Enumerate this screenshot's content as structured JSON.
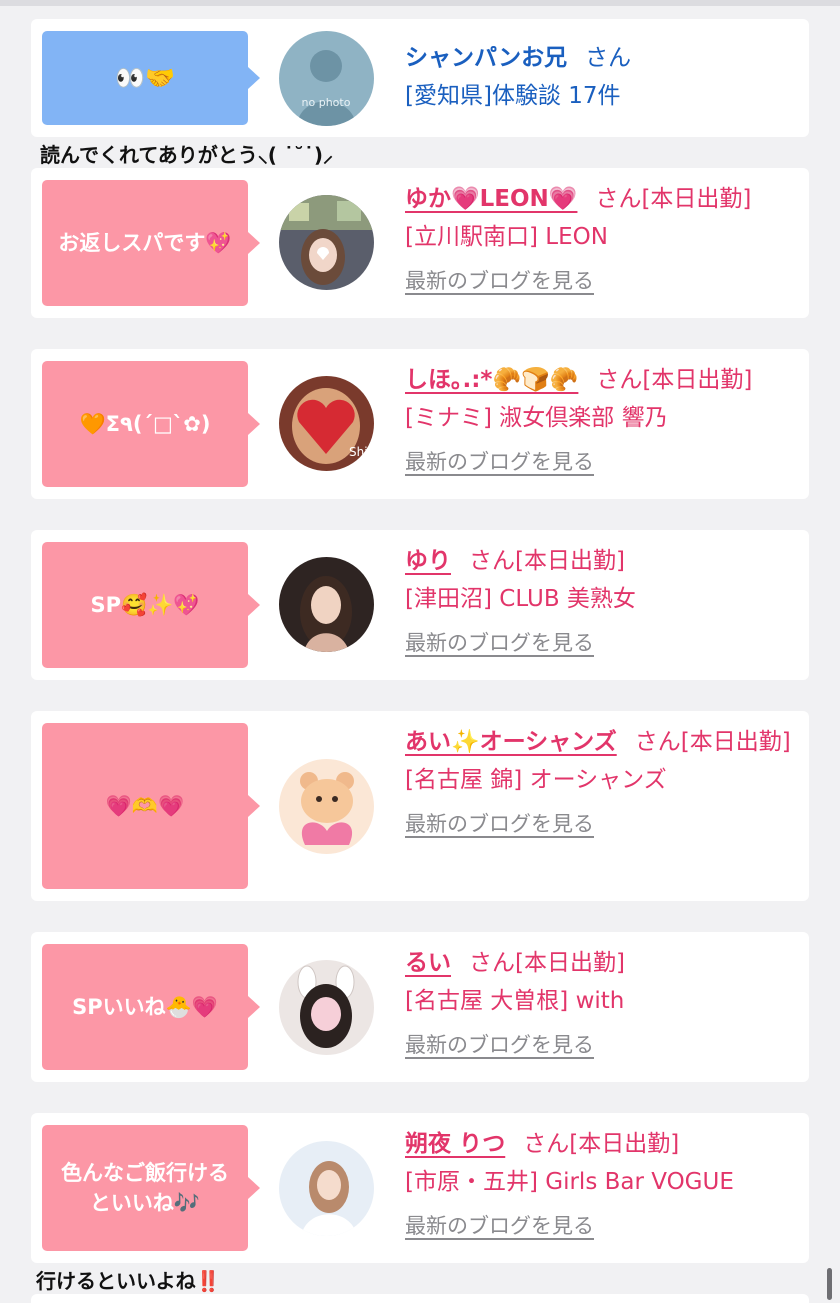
{
  "accent": {
    "pink": "#e2356a",
    "bubble_pink": "#fc97a6",
    "bubble_blue": "#82b4f5",
    "blue_text": "#1a5fbf"
  },
  "first": {
    "bubble": "👀🤝",
    "avatar_text": "no photo",
    "name": "シャンパンお兄",
    "san": "さん",
    "location": "[愛知県]体験談 17件"
  },
  "comment_top": "読んでくれてありがとう⸜( ˙˘˙)⸝",
  "comment_bottom": "行けるといいよね‼️",
  "entries": [
    {
      "bubble": "お返しスパです💖",
      "name": "ゆか💗LEON💗",
      "suffix": "さん[本日出勤]",
      "shop": "[立川駅南口] LEON",
      "blog": "最新のブログを見る"
    },
    {
      "bubble": "🧡Σ٩(ˊ□ˋ✿)",
      "name": "しほ｡.:*🥐🍞🥐",
      "suffix": "さん[本日出勤]",
      "shop": "[ミナミ] 淑女倶楽部 響乃",
      "blog": "最新のブログを見る"
    },
    {
      "bubble": "SP🥰✨💖",
      "name": "ゆり",
      "suffix": "さん[本日出勤]",
      "shop": "[津田沼] CLUB 美熟女",
      "blog": "最新のブログを見る"
    },
    {
      "bubble": "💗🫶💗",
      "name": "あい✨オーシャンズ",
      "suffix": "さん[本日出勤]",
      "shop": "[名古屋 錦] オーシャンズ",
      "blog": "最新のブログを見る"
    },
    {
      "bubble": "SPいいね🐣💗",
      "name": "るい",
      "suffix": "さん[本日出勤]",
      "shop": "[名古屋 大曽根] with",
      "blog": "最新のブログを見る"
    },
    {
      "bubble": "色んなご飯行けるといいね🎶",
      "name": "朔夜 りつ",
      "suffix": "さん[本日出勤]",
      "shop": "[市原・五井] Girls Bar VOGUE",
      "blog": "最新のブログを見る"
    }
  ]
}
